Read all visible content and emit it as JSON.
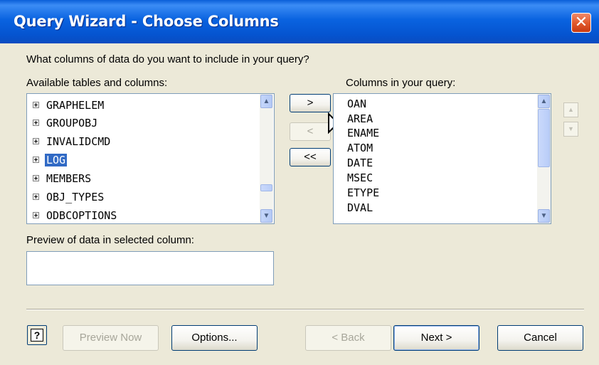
{
  "window": {
    "title": "Query Wizard - Choose Columns",
    "close_label": "✕"
  },
  "prompt": "What columns of data do you want to include in your query?",
  "available": {
    "label": "Available tables and columns:",
    "items": [
      "GRAPHELEM",
      "GROUPOBJ",
      "INVALIDCMD",
      "LOG",
      "MEMBERS",
      "OBJ_TYPES",
      "ODBCOPTIONS"
    ],
    "selected": "LOG"
  },
  "selected_columns": {
    "label": "Columns in your query:",
    "items": [
      "OAN",
      "AREA",
      "ENAME",
      "ATOM",
      "DATE",
      "MSEC",
      "ETYPE",
      "DVAL"
    ]
  },
  "move_buttons": {
    "add": ">",
    "remove": "<",
    "remove_all": "<<"
  },
  "order_buttons": {
    "up": "▲",
    "down": "▼"
  },
  "preview": {
    "label": "Preview of data in selected column:",
    "value": ""
  },
  "footer": {
    "help": "?",
    "preview_now": "Preview Now",
    "options": "Options...",
    "back": "< Back",
    "next": "Next >",
    "cancel": "Cancel"
  }
}
